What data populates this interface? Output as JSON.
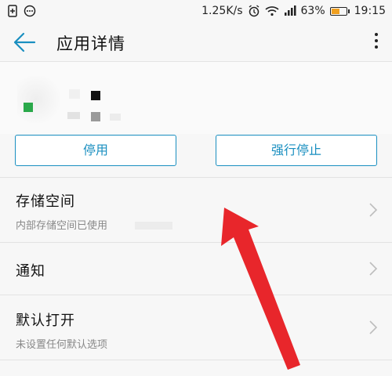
{
  "status_bar": {
    "speed": "1.25K/s",
    "battery_percent_text": "63%",
    "battery_level": 0.63,
    "time": "19:15",
    "battery_color": "#f0a020",
    "icons": [
      "sim-icon",
      "chat-bubble-icon",
      "alarm-icon",
      "wifi-icon",
      "signal-icon",
      "battery-icon"
    ]
  },
  "app_bar": {
    "title": "应用详情",
    "back_icon": "back-arrow-icon",
    "menu_icon": "more-vert-icon"
  },
  "actions": {
    "disable_label": "停用",
    "force_stop_label": "强行停止",
    "accent_color": "#1a8fc0"
  },
  "list": {
    "storage": {
      "title": "存储空间",
      "subtitle": "内部存储空间已使用"
    },
    "notifications": {
      "title": "通知"
    },
    "default_open": {
      "title": "默认打开",
      "subtitle": "未设置任何默认选项"
    }
  },
  "annotation_color": "#e8262b"
}
